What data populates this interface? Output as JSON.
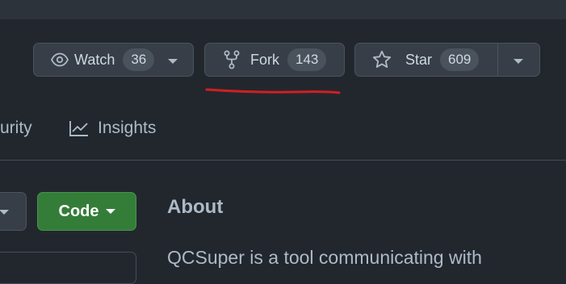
{
  "repo_actions": {
    "watch": {
      "label": "Watch",
      "count": "36"
    },
    "fork": {
      "label": "Fork",
      "count": "143"
    },
    "star": {
      "label": "Star",
      "count": "609"
    }
  },
  "tabs": [
    {
      "label": "urity"
    },
    {
      "label": "Insights"
    }
  ],
  "code_button": {
    "label": "Code"
  },
  "about": {
    "title": "About",
    "description": "QCSuper is a tool communicating with"
  },
  "annotation": {
    "color": "#d21f1f"
  }
}
